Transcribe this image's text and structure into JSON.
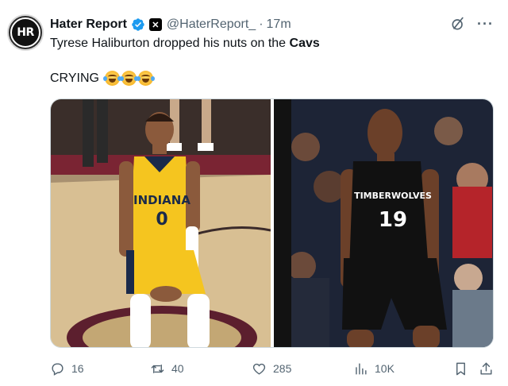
{
  "author": {
    "name": "Hater Report",
    "avatar_text": "HR",
    "handle": "@HaterReport_",
    "separator": "·",
    "time": "17m",
    "badge_icons": [
      "verified-badge-icon",
      "x-affiliate-icon"
    ]
  },
  "header_icons": [
    "grok-icon",
    "more-icon"
  ],
  "more_glyph": "···",
  "tweet": {
    "line1_prefix": "Tyrese Haliburton dropped his nuts on the ",
    "line1_bold": "Cavs",
    "line2": "CRYING",
    "emojis": [
      "face-with-tears-of-joy",
      "face-with-tears-of-joy",
      "face-with-tears-of-joy"
    ]
  },
  "media": {
    "left": {
      "jersey_team": "INDIANA",
      "jersey_number": "0",
      "jersey_color": "#f5c51f",
      "court_color": "#d9c29a"
    },
    "right": {
      "jersey_team": "TIMBERWOLVES",
      "jersey_number": "19",
      "jersey_color": "#111111",
      "crowd_color": "#1d2436"
    }
  },
  "actions": {
    "replies": "16",
    "reposts": "40",
    "likes": "285",
    "views": "10K"
  },
  "colors": {
    "text_primary": "#0f1419",
    "text_secondary": "#536471",
    "verified_blue": "#1d9bf0",
    "border": "#cfd9de"
  }
}
